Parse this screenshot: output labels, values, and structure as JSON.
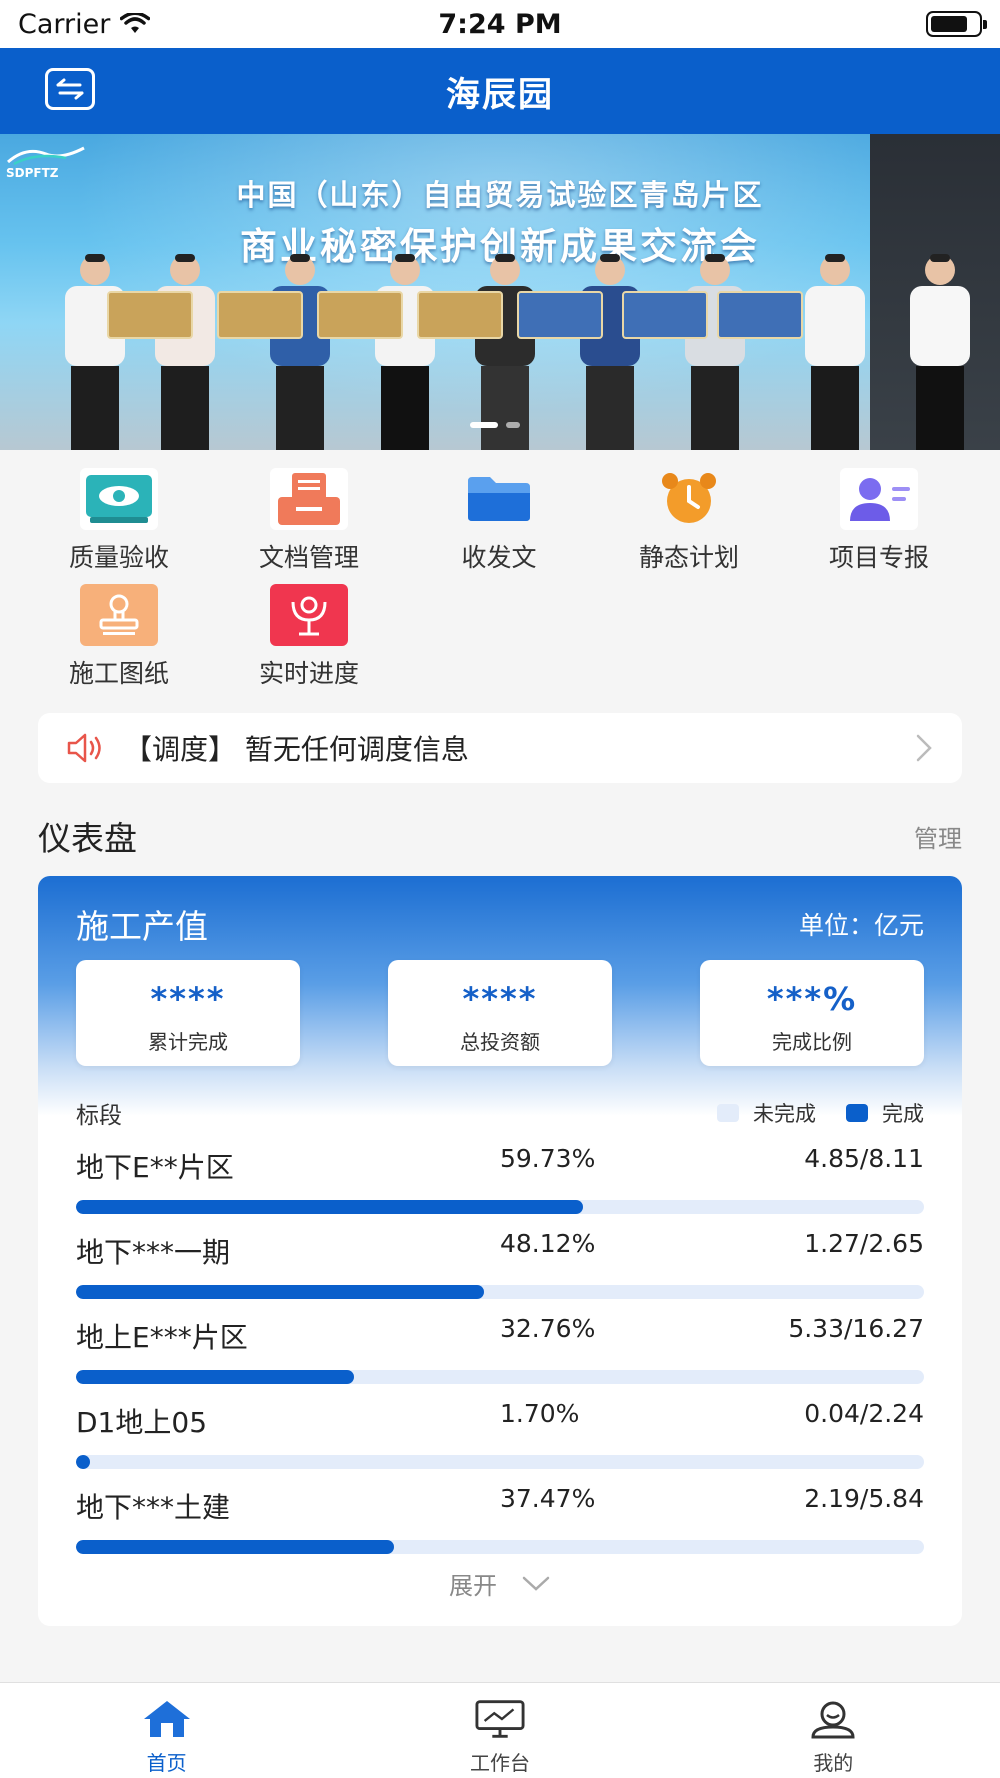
{
  "status_bar": {
    "carrier": "Carrier",
    "time": "7:24 PM"
  },
  "nav": {
    "title": "海辰园"
  },
  "banner": {
    "line1": "中国（山东）自由贸易试验区青岛片区",
    "line2": "商业秘密保护创新成果交流会",
    "logo_text": "SDPFTZ"
  },
  "menu": {
    "items": [
      {
        "label": "质量验收",
        "icon": "eye-screen-icon",
        "color": "#2bb3b8"
      },
      {
        "label": "文档管理",
        "icon": "document-tray-icon",
        "color": "#f07a5a"
      },
      {
        "label": "收发文",
        "icon": "folder-icon",
        "color": "#1e6fd9"
      },
      {
        "label": "静态计划",
        "icon": "alarm-clock-icon",
        "color": "#f39c2a"
      },
      {
        "label": "项目专报",
        "icon": "user-report-icon",
        "color": "#6d5ce8"
      },
      {
        "label": "施工图纸",
        "icon": "stamp-icon",
        "color": "#f5a46c"
      },
      {
        "label": "实时进度",
        "icon": "progress-person-icon",
        "color": "#f0364f"
      }
    ]
  },
  "notice": {
    "text": "【调度】 暂无任何调度信息"
  },
  "dashboard_section": {
    "title": "仪表盘",
    "manage": "管理"
  },
  "dashboard": {
    "title": "施工产值",
    "unit": "单位：亿元",
    "stats": [
      {
        "value": "****",
        "label": "累计完成"
      },
      {
        "value": "****",
        "label": "总投资额"
      },
      {
        "value": "***%",
        "label": "完成比例"
      }
    ],
    "segment_label": "标段",
    "legend_todo": "未完成",
    "legend_done": "完成",
    "rows": [
      {
        "name": "地下E**片区",
        "pct": "59.73%",
        "ratio": "4.85/8.11",
        "progress": 0.5973
      },
      {
        "name": "地下***一期",
        "pct": "48.12%",
        "ratio": "1.27/2.65",
        "progress": 0.4812
      },
      {
        "name": "地上E***片区",
        "pct": "32.76%",
        "ratio": "5.33/16.27",
        "progress": 0.3276
      },
      {
        "name": "D1地上05",
        "pct": "1.70%",
        "ratio": "0.04/2.24",
        "progress": 0.017
      },
      {
        "name": "地下***土建",
        "pct": "37.47%",
        "ratio": "2.19/5.84",
        "progress": 0.3747
      }
    ],
    "expand_label": "展开",
    "colors": {
      "done": "#0a5fcb",
      "todo": "#e3ecfa"
    }
  },
  "tabs": [
    {
      "label": "首页",
      "icon": "home-icon",
      "active": true
    },
    {
      "label": "工作台",
      "icon": "monitor-icon",
      "active": false
    },
    {
      "label": "我的",
      "icon": "user-icon",
      "active": false
    }
  ],
  "colors": {
    "primary": "#0a5fcb"
  }
}
